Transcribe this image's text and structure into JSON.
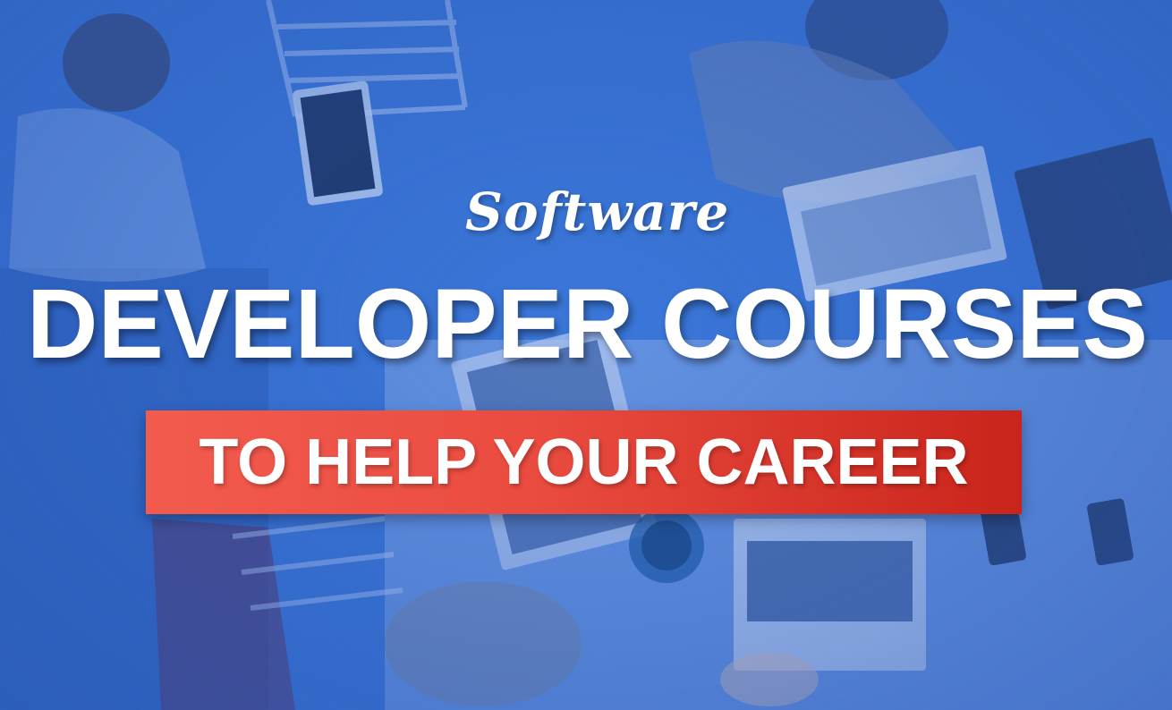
{
  "banner": {
    "script_word": "Software",
    "main_line": "DEVELOPER COURSES",
    "ribbon_text": "TO HELP YOUR CAREER"
  },
  "colors": {
    "background_blue": "#3570cf",
    "ribbon_red_start": "#f35b4f",
    "ribbon_red_end": "#c9241b",
    "text": "#ffffff"
  },
  "background_photo": "overhead view of people working with laptops and tablets at a desk"
}
